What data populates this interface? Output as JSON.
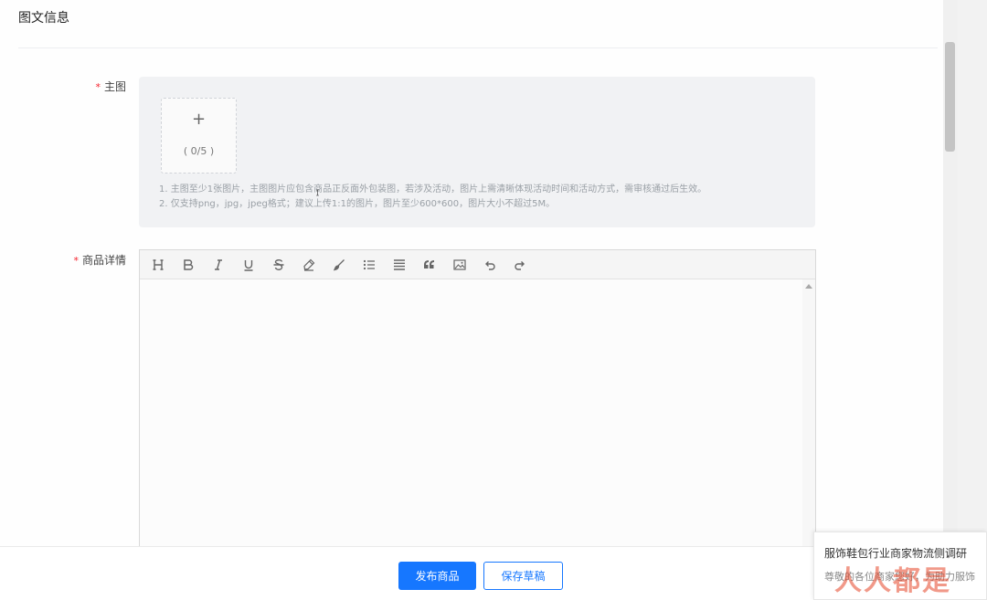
{
  "section": {
    "title": "图文信息"
  },
  "main_image": {
    "label": "主图",
    "required_mark": "*",
    "upload_plus": "+",
    "upload_count": "( 0/5 )",
    "hints": [
      "1. 主图至少1张图片，主图图片应包含商品正反面外包装图，若涉及活动，图片上需清晰体现活动时间和活动方式，需审核通过后生效。",
      "2. 仅支持png，jpg，jpeg格式；建议上传1:1的图片，图片至少600*600，图片大小不超过5M。"
    ]
  },
  "detail": {
    "label": "商品详情",
    "required_mark": "*",
    "toolbar": [
      "heading-icon",
      "bold-icon",
      "italic-icon",
      "underline-icon",
      "strikethrough-icon",
      "highlight-icon",
      "brush-icon",
      "bullet-list-icon",
      "align-icon",
      "quote-icon",
      "image-icon",
      "undo-icon",
      "redo-icon"
    ]
  },
  "footer": {
    "publish_label": "发布商品",
    "save_label": "保存草稿"
  },
  "popup": {
    "title": "服饰鞋包行业商家物流侧调研",
    "subtitle": "尊敬的各位商家您好，为助力服饰",
    "watermark": "人人都是"
  },
  "colors": {
    "accent": "#1677ff",
    "required": "#f5222d"
  }
}
